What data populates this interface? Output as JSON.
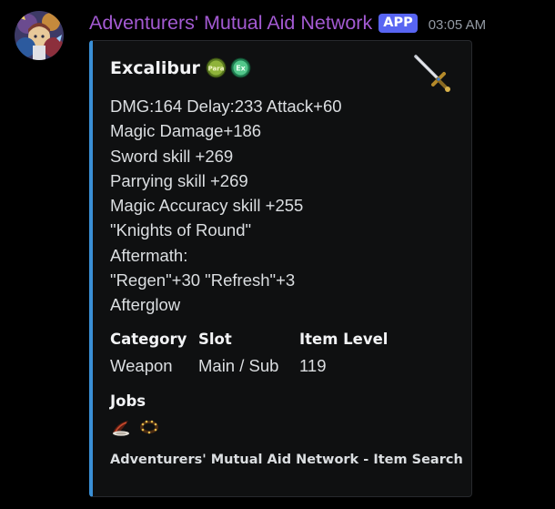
{
  "message": {
    "author": "Adventurers' Mutual Aid Network",
    "badge": "APP",
    "timestamp": "03:05 AM",
    "accent_color": "#a35ad2",
    "badge_color": "#5865f2"
  },
  "embed": {
    "border_color": "#3a8fd6",
    "title": "Excalibur",
    "title_emojis": [
      "para-icon",
      "ex-icon"
    ],
    "thumbnail": "sword-icon",
    "description_lines": [
      "DMG:164 Delay:233 Attack+60",
      "Magic Damage+186",
      "Sword skill +269",
      "Parrying skill +269",
      "Magic Accuracy skill +255",
      "\"Knights of Round\"",
      "Aftermath:",
      "\"Regen\"+30 \"Refresh\"+3",
      "Afterglow"
    ],
    "fields": [
      {
        "name": "Category",
        "value": "Weapon"
      },
      {
        "name": "Slot",
        "value": "Main / Sub"
      },
      {
        "name": "Item Level",
        "value": "119"
      }
    ],
    "jobs": {
      "name": "Jobs",
      "icons": [
        "paladin-job-icon",
        "rune-fencer-job-icon"
      ]
    },
    "footer": "Adventurers' Mutual Aid Network - Item Search"
  }
}
